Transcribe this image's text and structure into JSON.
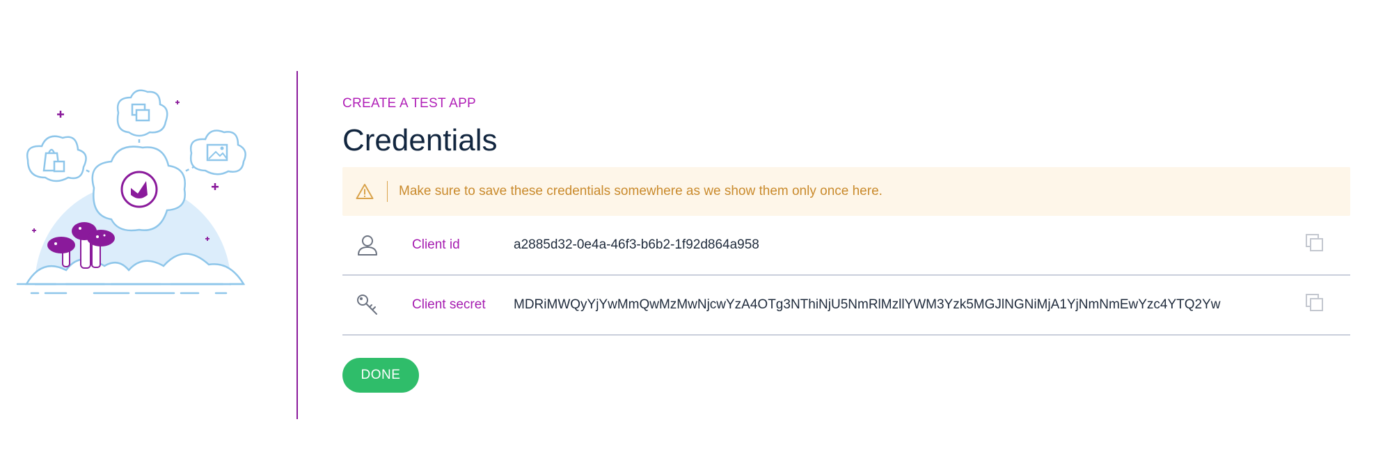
{
  "header": {
    "eyebrow": "CREATE A TEST APP",
    "title": "Credentials"
  },
  "warning": {
    "icon": "warning-triangle-icon",
    "message": "Make sure to save these credentials somewhere as we show them only once here."
  },
  "credentials": [
    {
      "icon": "user-icon",
      "label": "Client id",
      "value": "a2885d32-0e4a-46f3-b6b2-1f92d864a958",
      "copy_icon": "copy-icon"
    },
    {
      "icon": "key-icon",
      "label": "Client secret",
      "value": "MDRiMWQyYjYwMmQwMzMwNjcwYzA4OTg3NThiNjU5NmRlMzllYWM3Yzk5MGJlNGNiMjA1YjNmNmEwYzc4YTQ2Yw",
      "copy_icon": "copy-icon"
    }
  ],
  "actions": {
    "done_label": "DONE"
  },
  "colors": {
    "accent": "#a51cb0",
    "title": "#12263f",
    "warning_bg": "#fef6e9",
    "warning_text": "#c98a2c",
    "done_button": "#2fbd6a"
  }
}
